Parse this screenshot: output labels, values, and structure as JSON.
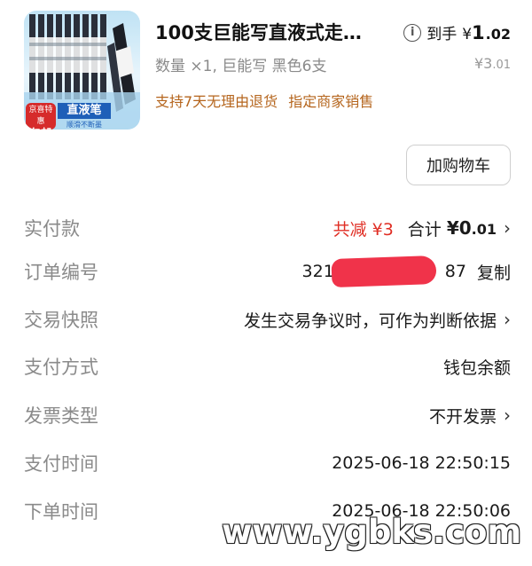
{
  "product": {
    "title": "100支巨能写直液式走…",
    "price_prefix": "到手",
    "price_yen": "¥",
    "price_int": "1",
    "price_dec": ".02",
    "spec": "数量 ×1, 巨能写 黑色6支",
    "original_yen": "¥",
    "original_int": "3",
    "original_dec": ".01",
    "service_tags": [
      "支持7天无理由退货",
      "指定商家销售"
    ],
    "thumb_badge_top": "京喜特惠",
    "thumb_badge_bottom": "包邮",
    "thumb_label": "直液笔",
    "thumb_sub": "顺滑不断墨"
  },
  "actions": {
    "add_to_cart": "加购物车"
  },
  "rows": {
    "paid": {
      "label": "实付款",
      "discount": "共减 ¥3",
      "total_prefix": "合计",
      "total_yen": "¥",
      "total_int": "0",
      "total_dec": ".01"
    },
    "order_no": {
      "label": "订单编号",
      "value_start": "321",
      "value_end": "87",
      "copy": "复制"
    },
    "snapshot": {
      "label": "交易快照",
      "value": "发生交易争议时，可作为判断依据"
    },
    "pay_method": {
      "label": "支付方式",
      "value": "钱包余额"
    },
    "invoice": {
      "label": "发票类型",
      "value": "不开发票"
    },
    "pay_time": {
      "label": "支付时间",
      "value": "2025-06-18 22:50:15"
    },
    "order_time": {
      "label": "下单时间",
      "value": "2025-06-18 22:50:06"
    }
  },
  "watermark": "www.ygbks.com",
  "colors": {
    "accent_red": "#e02e24",
    "service_orange": "#b5651d",
    "label_gray": "#8a8a8a"
  }
}
